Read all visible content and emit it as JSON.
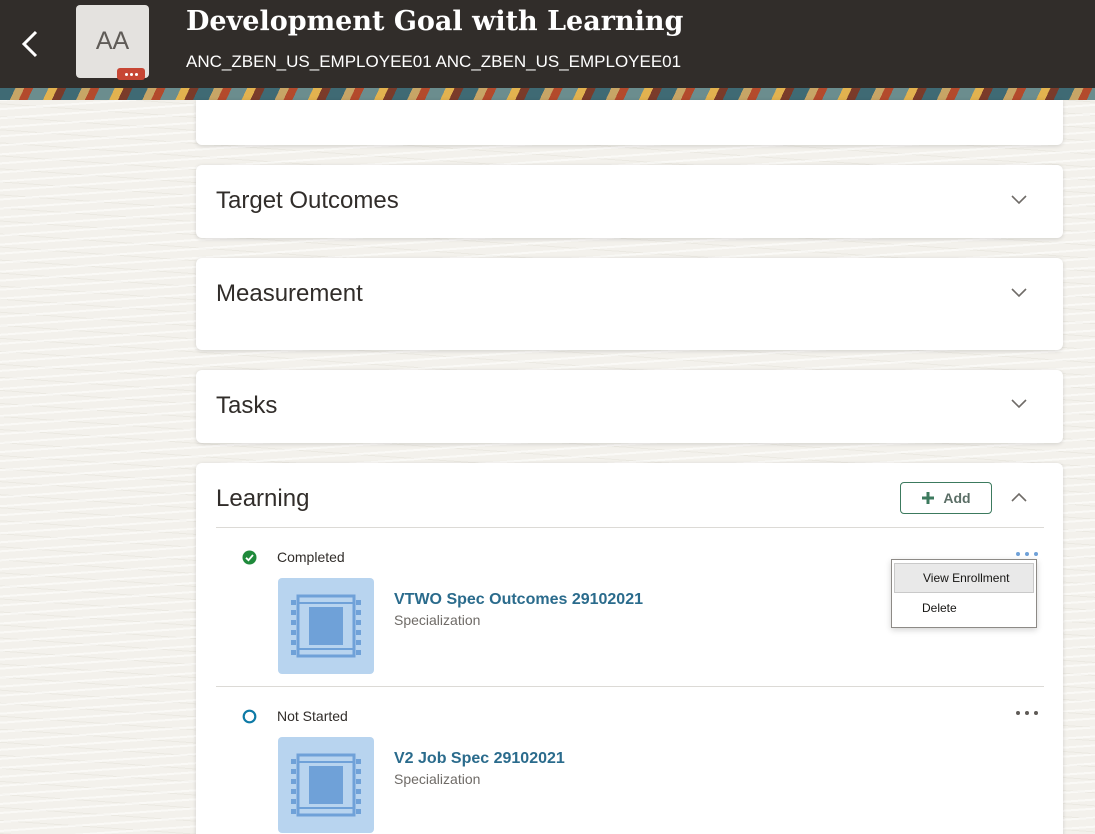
{
  "header": {
    "title": "Development Goal with Learning",
    "subtitle": "ANC_ZBEN_US_EMPLOYEE01 ANC_ZBEN_US_EMPLOYEE01",
    "avatar_initials": "AA",
    "back_icon": "chevron-left-icon",
    "colors": {
      "header_bg": "#312d2a",
      "badge": "#c74634"
    }
  },
  "sections": {
    "target_outcomes": {
      "title": "Target Outcomes"
    },
    "measurement": {
      "title": "Measurement"
    },
    "tasks": {
      "title": "Tasks"
    },
    "learning": {
      "title": "Learning",
      "add_label": "Add",
      "items": [
        {
          "status": "Completed",
          "status_icon": "check-circle-icon",
          "title": "VTWO Spec Outcomes 29102021",
          "type": "Specialization"
        },
        {
          "status": "Not Started",
          "status_icon": "empty-circle-icon",
          "title": "V2 Job Spec 29102021",
          "type": "Specialization"
        }
      ]
    }
  },
  "context_menu": {
    "items": [
      "View Enrollment",
      "Delete"
    ],
    "active_index": 0
  },
  "colors": {
    "accent_green": "#3c7a5e",
    "link_blue": "#2a6b8c",
    "status_complete": "#1f8a3b",
    "status_pending": "#0e7aa6"
  }
}
